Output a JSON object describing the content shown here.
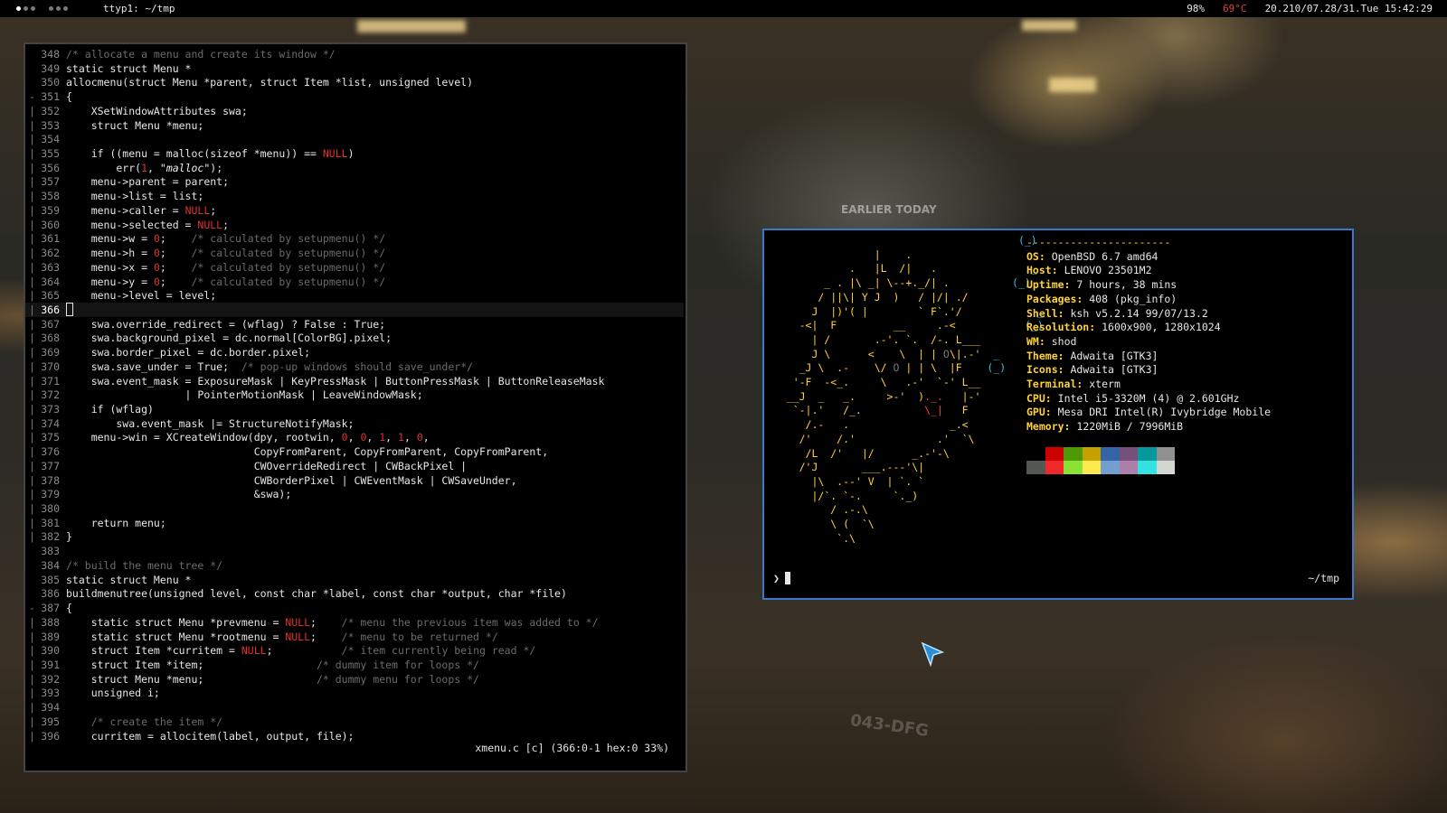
{
  "topbar": {
    "title": "ttyp1: ~/tmp",
    "battery": "98%",
    "temperature": "69°C",
    "datetime": "20.210/07.28/31.Tue 15:42:29"
  },
  "editor": {
    "lines": [
      {
        "n": "348",
        "m": "",
        "t": [
          [
            "c",
            "/* allocate a menu and create its window */"
          ]
        ]
      },
      {
        "n": "349",
        "m": "",
        "t": [
          [
            "n",
            "static struct Menu *"
          ]
        ]
      },
      {
        "n": "350",
        "m": "",
        "t": [
          [
            "n",
            "allocmenu(struct Menu *parent, struct Item *list, unsigned level)"
          ]
        ]
      },
      {
        "n": "351",
        "m": "-",
        "t": [
          [
            "n",
            "{"
          ]
        ]
      },
      {
        "n": "352",
        "m": "|",
        "t": [
          [
            "n",
            "    XSetWindowAttributes swa;"
          ]
        ]
      },
      {
        "n": "353",
        "m": "|",
        "t": [
          [
            "n",
            "    struct Menu *menu;"
          ]
        ]
      },
      {
        "n": "354",
        "m": "|",
        "t": [
          [
            "n",
            ""
          ]
        ]
      },
      {
        "n": "355",
        "m": "|",
        "t": [
          [
            "n",
            "    if ((menu = malloc(sizeof *menu)) == "
          ],
          [
            "r",
            "NULL"
          ],
          [
            "n",
            ")"
          ]
        ]
      },
      {
        "n": "356",
        "m": "|",
        "t": [
          [
            "n",
            "        err("
          ],
          [
            "r",
            "1"
          ],
          [
            "n",
            ", "
          ],
          [
            "s",
            "\"malloc\""
          ],
          [
            "n",
            ");"
          ]
        ]
      },
      {
        "n": "357",
        "m": "|",
        "t": [
          [
            "n",
            "    menu->parent = parent;"
          ]
        ]
      },
      {
        "n": "358",
        "m": "|",
        "t": [
          [
            "n",
            "    menu->list = list;"
          ]
        ]
      },
      {
        "n": "359",
        "m": "|",
        "t": [
          [
            "n",
            "    menu->caller = "
          ],
          [
            "r",
            "NULL"
          ],
          [
            "n",
            ";"
          ]
        ]
      },
      {
        "n": "360",
        "m": "|",
        "t": [
          [
            "n",
            "    menu->selected = "
          ],
          [
            "r",
            "NULL"
          ],
          [
            "n",
            ";"
          ]
        ]
      },
      {
        "n": "361",
        "m": "|",
        "t": [
          [
            "n",
            "    menu->w = "
          ],
          [
            "r",
            "0"
          ],
          [
            "n",
            ";    "
          ],
          [
            "c",
            "/* calculated by setupmenu() */"
          ]
        ]
      },
      {
        "n": "362",
        "m": "|",
        "t": [
          [
            "n",
            "    menu->h = "
          ],
          [
            "r",
            "0"
          ],
          [
            "n",
            ";    "
          ],
          [
            "c",
            "/* calculated by setupmenu() */"
          ]
        ]
      },
      {
        "n": "363",
        "m": "|",
        "t": [
          [
            "n",
            "    menu->x = "
          ],
          [
            "r",
            "0"
          ],
          [
            "n",
            ";    "
          ],
          [
            "c",
            "/* calculated by setupmenu() */"
          ]
        ]
      },
      {
        "n": "364",
        "m": "|",
        "t": [
          [
            "n",
            "    menu->y = "
          ],
          [
            "r",
            "0"
          ],
          [
            "n",
            ";    "
          ],
          [
            "c",
            "/* calculated by setupmenu() */"
          ]
        ]
      },
      {
        "n": "365",
        "m": "|",
        "t": [
          [
            "n",
            "    menu->level = level;"
          ]
        ]
      },
      {
        "n": "366",
        "m": "|",
        "t": [
          [
            "cur",
            ""
          ]
        ],
        "current": true
      },
      {
        "n": "367",
        "m": "|",
        "t": [
          [
            "n",
            "    swa.override_redirect = (wflag) ? False : True;"
          ]
        ]
      },
      {
        "n": "368",
        "m": "|",
        "t": [
          [
            "n",
            "    swa.background_pixel = dc.normal[ColorBG].pixel;"
          ]
        ]
      },
      {
        "n": "369",
        "m": "|",
        "t": [
          [
            "n",
            "    swa.border_pixel = dc.border.pixel;"
          ]
        ]
      },
      {
        "n": "370",
        "m": "|",
        "t": [
          [
            "n",
            "    swa.save_under = True;  "
          ],
          [
            "c",
            "/* pop-up windows should save_under*/"
          ]
        ]
      },
      {
        "n": "371",
        "m": "|",
        "t": [
          [
            "n",
            "    swa.event_mask = ExposureMask | KeyPressMask | ButtonPressMask | ButtonReleaseMask"
          ]
        ]
      },
      {
        "n": "372",
        "m": "|",
        "t": [
          [
            "n",
            "                   | PointerMotionMask | LeaveWindowMask;"
          ]
        ]
      },
      {
        "n": "373",
        "m": "|",
        "t": [
          [
            "n",
            "    if (wflag)"
          ]
        ]
      },
      {
        "n": "374",
        "m": "|",
        "t": [
          [
            "n",
            "        swa.event_mask |= StructureNotifyMask;"
          ]
        ]
      },
      {
        "n": "375",
        "m": "|",
        "t": [
          [
            "n",
            "    menu->win = XCreateWindow(dpy, rootwin, "
          ],
          [
            "r",
            "0"
          ],
          [
            "n",
            ", "
          ],
          [
            "r",
            "0"
          ],
          [
            "n",
            ", "
          ],
          [
            "r",
            "1"
          ],
          [
            "n",
            ", "
          ],
          [
            "r",
            "1"
          ],
          [
            "n",
            ", "
          ],
          [
            "r",
            "0"
          ],
          [
            "n",
            ","
          ]
        ]
      },
      {
        "n": "376",
        "m": "|",
        "t": [
          [
            "n",
            "                              CopyFromParent, CopyFromParent, CopyFromParent,"
          ]
        ]
      },
      {
        "n": "377",
        "m": "|",
        "t": [
          [
            "n",
            "                              CWOverrideRedirect | CWBackPixel |"
          ]
        ]
      },
      {
        "n": "378",
        "m": "|",
        "t": [
          [
            "n",
            "                              CWBorderPixel | CWEventMask | CWSaveUnder,"
          ]
        ]
      },
      {
        "n": "379",
        "m": "|",
        "t": [
          [
            "n",
            "                              &swa);"
          ]
        ]
      },
      {
        "n": "380",
        "m": "|",
        "t": [
          [
            "n",
            ""
          ]
        ]
      },
      {
        "n": "381",
        "m": "|",
        "t": [
          [
            "n",
            "    return menu;"
          ]
        ]
      },
      {
        "n": "382",
        "m": "|",
        "t": [
          [
            "n",
            "}"
          ]
        ]
      },
      {
        "n": "383",
        "m": "",
        "t": [
          [
            "n",
            ""
          ]
        ]
      },
      {
        "n": "384",
        "m": "",
        "t": [
          [
            "c",
            "/* build the menu tree */"
          ]
        ]
      },
      {
        "n": "385",
        "m": "",
        "t": [
          [
            "n",
            "static struct Menu *"
          ]
        ]
      },
      {
        "n": "386",
        "m": "",
        "t": [
          [
            "n",
            "buildmenutree(unsigned level, const char *label, const char *output, char *file)"
          ]
        ]
      },
      {
        "n": "387",
        "m": "-",
        "t": [
          [
            "n",
            "{"
          ]
        ]
      },
      {
        "n": "388",
        "m": "|",
        "t": [
          [
            "n",
            "    static struct Menu *prevmenu = "
          ],
          [
            "r",
            "NULL"
          ],
          [
            "n",
            ";    "
          ],
          [
            "c",
            "/* menu the previous item was added to */"
          ]
        ]
      },
      {
        "n": "389",
        "m": "|",
        "t": [
          [
            "n",
            "    static struct Menu *rootmenu = "
          ],
          [
            "r",
            "NULL"
          ],
          [
            "n",
            ";    "
          ],
          [
            "c",
            "/* menu to be returned */"
          ]
        ]
      },
      {
        "n": "390",
        "m": "|",
        "t": [
          [
            "n",
            "    struct Item *curritem = "
          ],
          [
            "r",
            "NULL"
          ],
          [
            "n",
            ";           "
          ],
          [
            "c",
            "/* item currently being read */"
          ]
        ]
      },
      {
        "n": "391",
        "m": "|",
        "t": [
          [
            "n",
            "    struct Item *item;                  "
          ],
          [
            "c",
            "/* dummy item for loops */"
          ]
        ]
      },
      {
        "n": "392",
        "m": "|",
        "t": [
          [
            "n",
            "    struct Menu *menu;                  "
          ],
          [
            "c",
            "/* dummy menu for loops */"
          ]
        ]
      },
      {
        "n": "393",
        "m": "|",
        "t": [
          [
            "n",
            "    unsigned i;"
          ]
        ]
      },
      {
        "n": "394",
        "m": "|",
        "t": [
          [
            "n",
            ""
          ]
        ]
      },
      {
        "n": "395",
        "m": "|",
        "t": [
          [
            "n",
            "    "
          ],
          [
            "c",
            "/* create the item */"
          ]
        ]
      },
      {
        "n": "396",
        "m": "|",
        "t": [
          [
            "n",
            "    curritem = allocitem(label, output, file);"
          ]
        ]
      }
    ],
    "status": "xmenu.c [c] (366:0-1 hex:0 33%)"
  },
  "neofetch": {
    "logo": [
      [
        [
          "c",
          "                                        (_)"
        ]
      ],
      [
        [
          "y",
          "                 |    ."
        ]
      ],
      [
        [
          "y",
          "             .   |L  /|   .               "
        ],
        [
          "c",
          "_"
        ]
      ],
      [
        [
          "y",
          "         _ . |\\ _| \\--+._/| .          "
        ],
        [
          "c",
          "(_)"
        ]
      ],
      [
        [
          "y",
          "        / ||\\| Y J  )   / |/| ./"
        ]
      ],
      [
        [
          "y",
          "       J  |)'( |        ` F`.'/            "
        ],
        [
          "c",
          "_"
        ]
      ],
      [
        [
          "y",
          "     -<|  F         __     .-<           "
        ],
        [
          "c",
          "(_)"
        ]
      ],
      [
        [
          "y",
          "       | /       .-'. `.  /-. L___"
        ]
      ],
      [
        [
          "y",
          "       J \\      <    \\  | | "
        ],
        [
          "g",
          "O"
        ],
        [
          "y",
          "\\|.-'  "
        ],
        [
          "c",
          "_"
        ]
      ],
      [
        [
          "y",
          "     _J \\  .-    \\/ "
        ],
        [
          "g",
          "O"
        ],
        [
          "y",
          " | | \\  |F    "
        ],
        [
          "c",
          "(_)"
        ]
      ],
      [
        [
          "y",
          "    '-F  -<_.     \\   .-'  `-' L__"
        ]
      ],
      [
        [
          "y",
          "   __J  _   _.     >-'  )"
        ],
        [
          "r",
          "._."
        ],
        [
          "y",
          "   |-'"
        ]
      ],
      [
        [
          "y",
          "    `-|.'   /_.          "
        ],
        [
          "r",
          "\\_|"
        ],
        [
          "y",
          "   F"
        ]
      ],
      [
        [
          "y",
          "      /.-   .                _.<"
        ]
      ],
      [
        [
          "y",
          "     /'    /.'             .'  `\\"
        ]
      ],
      [
        [
          "y",
          "      /L  /'   |/      _.-'-\\"
        ]
      ],
      [
        [
          "y",
          "     /'J       ___.---'\\|"
        ]
      ],
      [
        [
          "y",
          "       |\\  .--' V  | `. `"
        ]
      ],
      [
        [
          "y",
          "       |/`. `-.     `._)"
        ]
      ],
      [
        [
          "y",
          "          / .-.\\"
        ]
      ],
      [
        [
          "y",
          "          \\ (  `\\"
        ]
      ],
      [
        [
          "y",
          "           `.\\"
        ]
      ]
    ],
    "separator": "-----------------------",
    "info": [
      {
        "key": "OS",
        "value": "OpenBSD 6.7 amd64"
      },
      {
        "key": "Host",
        "value": "LENOVO 23501M2"
      },
      {
        "key": "Uptime",
        "value": "7 hours, 38 mins"
      },
      {
        "key": "Packages",
        "value": "408 (pkg_info)"
      },
      {
        "key": "Shell",
        "value": "ksh v5.2.14 99/07/13.2"
      },
      {
        "key": "Resolution",
        "value": "1600x900, 1280x1024"
      },
      {
        "key": "WM",
        "value": "shod"
      },
      {
        "key": "Theme",
        "value": "Adwaita [GTK3]"
      },
      {
        "key": "Icons",
        "value": "Adwaita [GTK3]"
      },
      {
        "key": "Terminal",
        "value": "xterm"
      },
      {
        "key": "CPU",
        "value": "Intel i5-3320M (4) @ 2.601GHz"
      },
      {
        "key": "GPU",
        "value": "Mesa DRI Intel(R) Ivybridge Mobile"
      },
      {
        "key": "Memory",
        "value": "1220MiB / 7996MiB"
      }
    ],
    "palette": [
      "#000000",
      "#cc0000",
      "#4e9a06",
      "#c4a000",
      "#3465a4",
      "#75507b",
      "#06989a",
      "#909090",
      "#555753",
      "#ef2929",
      "#8ae234",
      "#fce94f",
      "#729fcf",
      "#ad7fa8",
      "#34e2e2",
      "#d3d7cf"
    ],
    "prompt": "❯",
    "cwd": "~/tmp"
  },
  "background": {
    "sign": "EARLIER TODAY",
    "plate": "043-DFG"
  }
}
